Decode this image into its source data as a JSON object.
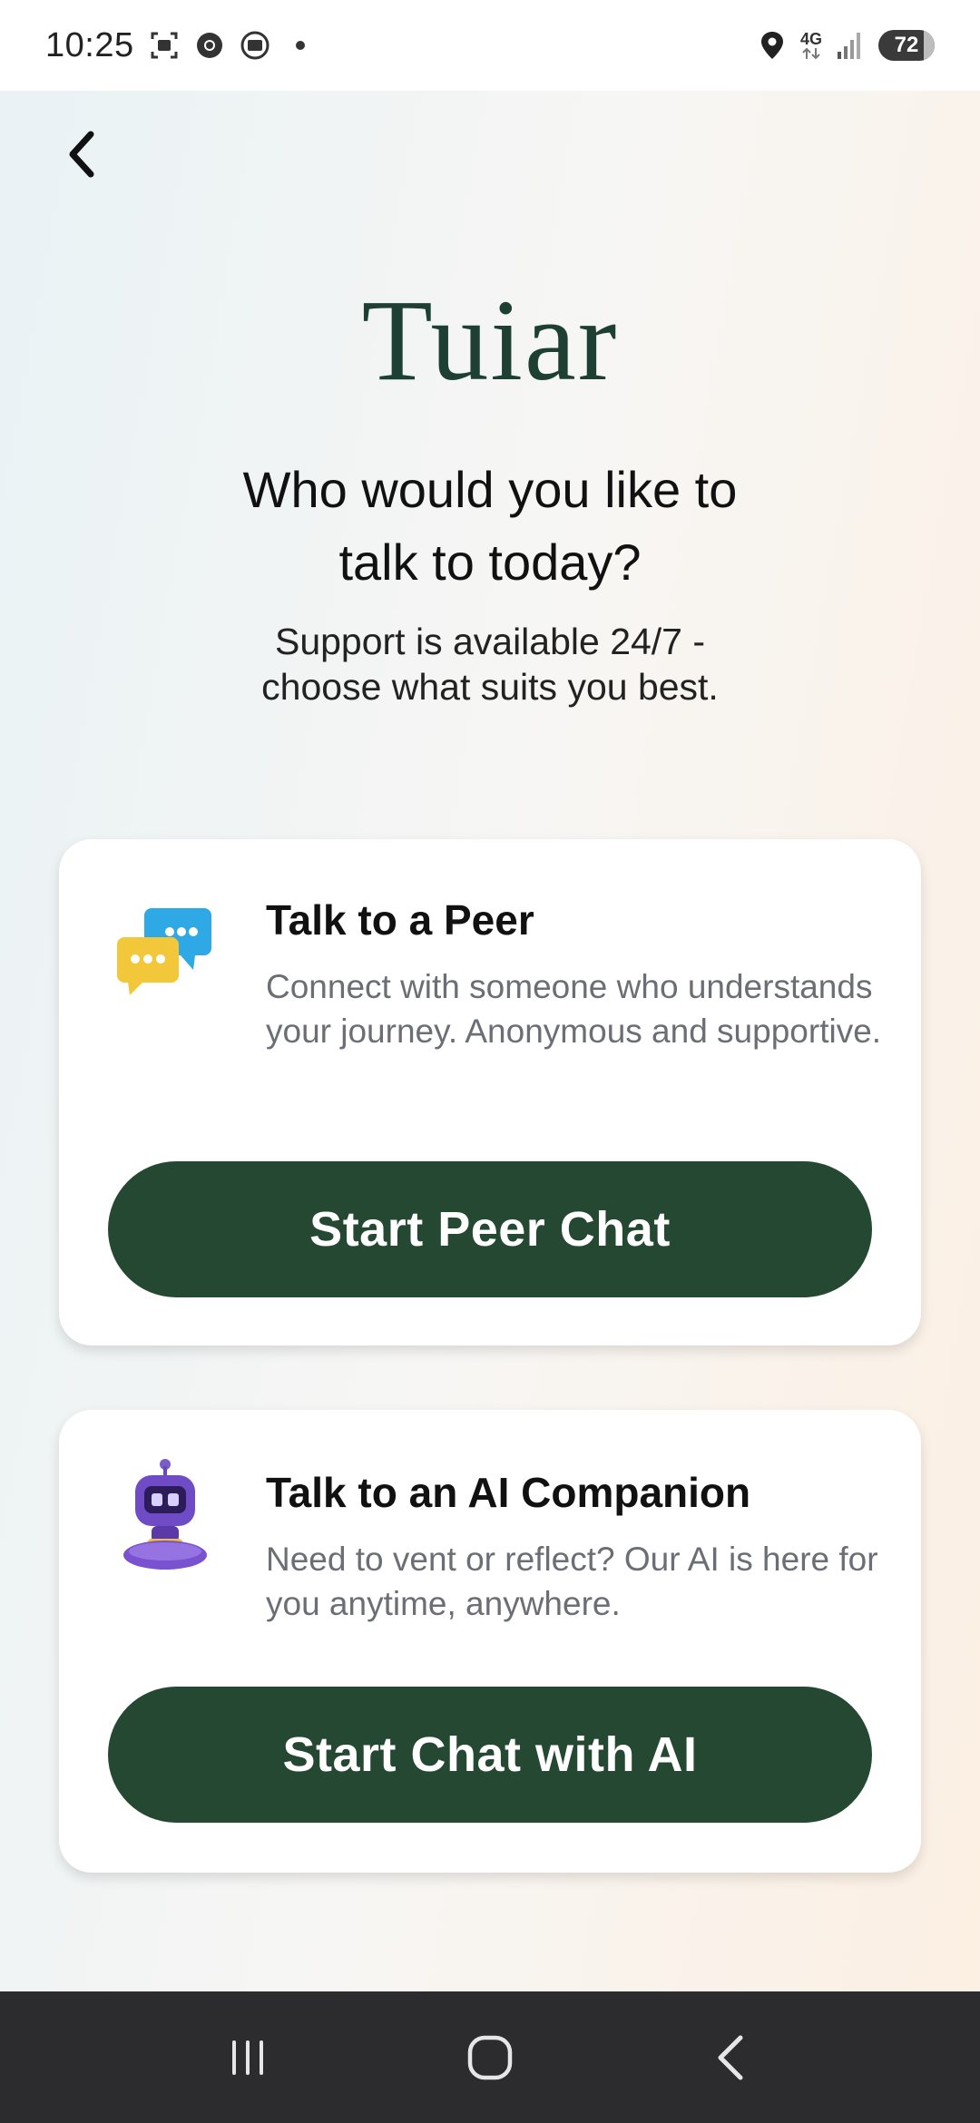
{
  "status_bar": {
    "time": "10:25",
    "network_type": "4G",
    "battery_level": "72",
    "left_icons": [
      "screenshot-icon",
      "chrome-icon",
      "media-icon",
      "notification-dot-icon"
    ],
    "right_icons": [
      "location-icon",
      "network-4g-icon",
      "signal-icon",
      "battery-icon"
    ]
  },
  "header": {
    "back_icon": "chevron-left-icon",
    "logo_text": "Tuiar"
  },
  "intro": {
    "headline_line1": "Who would you like to",
    "headline_line2": "talk to today?",
    "subhead_line1": "Support is available 24/7 -",
    "subhead_line2": "choose what suits you best."
  },
  "cards": [
    {
      "icon": "chat-bubbles-icon",
      "title": "Talk to a Peer",
      "description": "Connect with someone who understands your journey. Anonymous and supportive.",
      "button_label": "Start Peer Chat"
    },
    {
      "icon": "robot-icon",
      "title": "Talk to an AI Companion",
      "description": "Need to vent or reflect? Our AI is here for you anytime, anywhere.",
      "button_label": "Start Chat with AI"
    }
  ],
  "nav_bar": {
    "icons": [
      "recent-apps-icon",
      "home-icon",
      "back-icon"
    ]
  },
  "colors": {
    "brand_green": "#254833",
    "logo_green": "#1e3f33",
    "logo_accent_teal": "#2f6f78",
    "description_gray": "#6b6f75",
    "nav_bar": "#2c2c2e"
  }
}
